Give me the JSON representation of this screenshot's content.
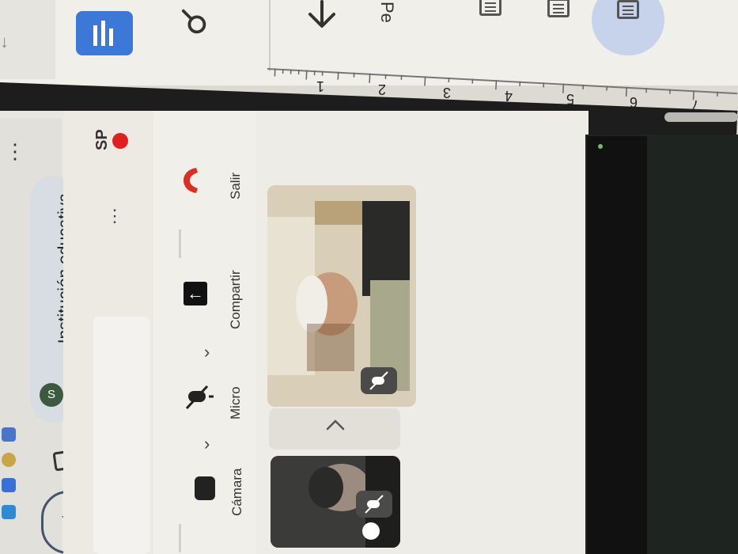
{
  "docs_toolbar": {
    "tab_label_partial": "Pe",
    "icons": [
      "app-icon",
      "search-icon",
      "download-icon",
      "format-icon",
      "format-icon",
      "format-icon-active"
    ]
  },
  "ruler": {
    "numbers": [
      "1",
      "2",
      "3",
      "4",
      "5",
      "6",
      "7"
    ]
  },
  "browser": {
    "more_label": "⋮",
    "chip_badge": "S",
    "chip_text": "Institución educativa",
    "star_label": "☆"
  },
  "meet": {
    "avatar_initials": "SP",
    "more_label": "⋮",
    "controls": {
      "leave_label": "Salir",
      "share_label": "Compartir",
      "mic_label": "Micro",
      "camera_label": "Cámara"
    }
  },
  "colors": {
    "accent_blue": "#3c78d8",
    "leave_red": "#d93025",
    "badge_red": "#e02020"
  }
}
